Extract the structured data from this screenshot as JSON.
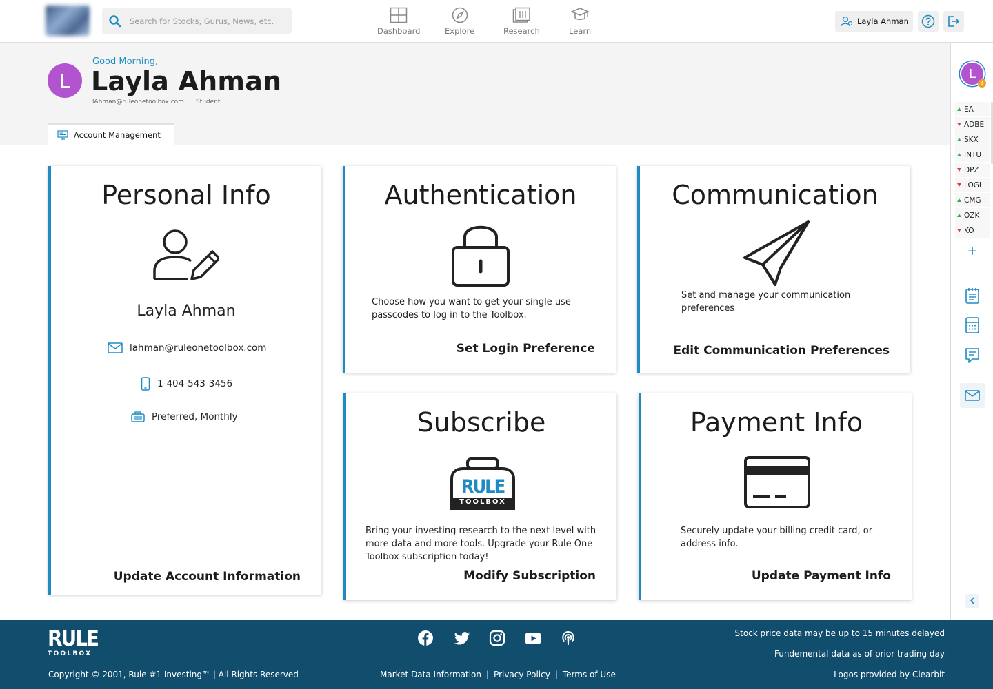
{
  "search": {
    "placeholder": "Search for Stocks, Gurus, News, etc."
  },
  "nav": [
    {
      "label": "Dashboard"
    },
    {
      "label": "Explore"
    },
    {
      "label": "Research"
    },
    {
      "label": "Learn"
    }
  ],
  "user": {
    "name": "Layla Ahman",
    "initial": "L"
  },
  "header": {
    "greeting": "Good Morning,",
    "name": "Layla Ahman",
    "email": "lAhman@ruleonetoolbox.com",
    "role": "Student",
    "tab": "Account Management"
  },
  "cards": {
    "personal": {
      "title": "Personal Info",
      "name": "Layla Ahman",
      "email": "lahman@ruleonetoolbox.com",
      "phone": "1-404-543-3456",
      "plan": "Preferred, Monthly",
      "link": "Update Account Information"
    },
    "auth": {
      "title": "Authentication",
      "desc": "Choose how you want to get your single use passcodes to log in to the Toolbox.",
      "link": "Set Login Preference"
    },
    "comm": {
      "title": "Communication",
      "desc": "Set and manage your communication preferences",
      "link": "Edit Communication Preferences"
    },
    "subscribe": {
      "title": "Subscribe",
      "desc": "Bring your investing research to the next level with more data and more tools. Upgrade your Rule One Toolbox subscription today!",
      "link": "Modify Subscription",
      "logo_word_top": "RULE",
      "logo_word_bottom": "TOOLBOX"
    },
    "payment": {
      "title": "Payment Info",
      "desc": "Securely update your billing credit card, or address info.",
      "link": "Update Payment Info"
    }
  },
  "rail": {
    "badge": "4",
    "tickers": [
      {
        "symbol": "EA",
        "dir": "up"
      },
      {
        "symbol": "ADBE",
        "dir": "down"
      },
      {
        "symbol": "SKX",
        "dir": "up"
      },
      {
        "symbol": "INTU",
        "dir": "up"
      },
      {
        "symbol": "DPZ",
        "dir": "down"
      },
      {
        "symbol": "LOGI",
        "dir": "down"
      },
      {
        "symbol": "CMG",
        "dir": "up"
      },
      {
        "symbol": "OZK",
        "dir": "up"
      },
      {
        "symbol": "KO",
        "dir": "down"
      }
    ],
    "add": "+"
  },
  "footer": {
    "logo_top": "RULE",
    "logo_bottom": "TOOLBOX",
    "copyright": "Copyright © 2001, Rule #1 Investing™ | All Rights Reserved",
    "links": [
      "Market Data Information",
      "Privacy Policy",
      "Terms of Use"
    ],
    "notes": [
      "Stock price data may be up to 15 minutes delayed",
      "Fundemental data as of prior trading day",
      "Logos provided by Clearbit"
    ]
  },
  "colors": {
    "accent": "#1f8bc2",
    "avatar": "#b253d0",
    "footer": "#114e6e",
    "up": "#2fae4e",
    "down": "#e03a3a"
  }
}
